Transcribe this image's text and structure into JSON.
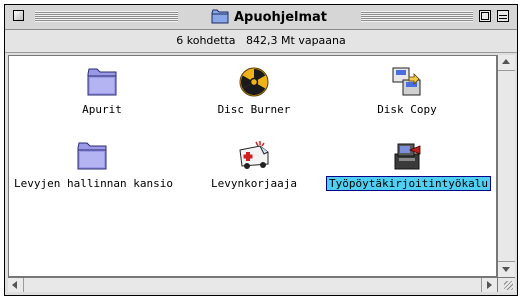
{
  "window": {
    "title": "Apuohjelmat",
    "info": "6 kohdetta   842,3 Mt vapaana"
  },
  "items": [
    {
      "label": "Apurit",
      "icon": "folder-icon"
    },
    {
      "label": "Disc Burner",
      "icon": "radiation-disc-icon"
    },
    {
      "label": "Disk Copy",
      "icon": "disk-copy-icon"
    },
    {
      "label": "Levyjen hallinnan kansio",
      "icon": "folder-icon"
    },
    {
      "label": "Levynkorjaaja",
      "icon": "ambulance-icon"
    },
    {
      "label": "Työpöytäkirjoitintyökalu",
      "icon": "printer-icon",
      "selected": true
    }
  ],
  "colors": {
    "selection": "#4fd0f2",
    "folder": "#8c8ce0",
    "window_bg": "#dedede"
  }
}
